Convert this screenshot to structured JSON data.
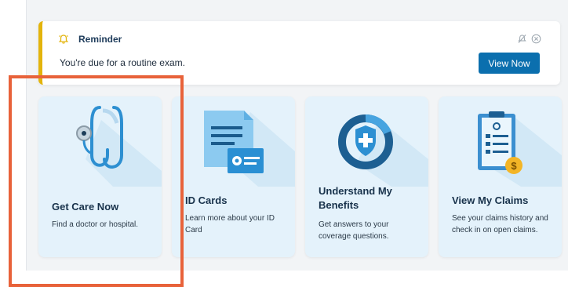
{
  "reminder": {
    "title": "Reminder",
    "message": "You're due for a routine exam.",
    "button_label": "View Now",
    "accent_color": "#e3b40c",
    "icons": [
      "bell-icon",
      "snooze-icon",
      "close-icon"
    ]
  },
  "cards": [
    {
      "title": "Get Care Now",
      "description": "Find a doctor or hospital.",
      "icon": "stethoscope-icon"
    },
    {
      "title": "ID Cards",
      "description": "Learn more about your ID Card",
      "icon": "id-card-icon"
    },
    {
      "title": "Understand My Benefits",
      "description": "Get answers to your coverage questions.",
      "icon": "benefits-shield-icon"
    },
    {
      "title": "View My Claims",
      "description": "See your claims history and check in on open claims.",
      "icon": "claims-clipboard-icon"
    }
  ],
  "colors": {
    "primary_button": "#0b6fae",
    "card_background": "#e4f2fb",
    "highlight_border": "#e8623a"
  }
}
